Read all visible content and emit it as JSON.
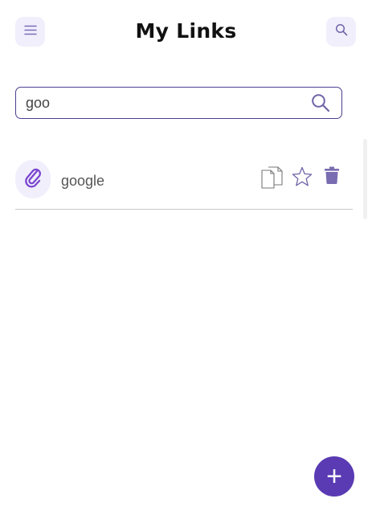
{
  "header": {
    "title": "My Links",
    "menu_icon": "hamburger-menu-icon",
    "search_icon": "search-icon"
  },
  "search": {
    "value": "goo",
    "icon": "search-icon"
  },
  "links": [
    {
      "name": "google",
      "icon": "paperclip-icon",
      "actions": [
        "copy-icon",
        "star-icon",
        "trash-icon"
      ]
    }
  ],
  "fab": {
    "label": "+",
    "icon": "plus-icon"
  },
  "colors": {
    "accent": "#5a3bb3",
    "icon_bg": "#f1effc",
    "icon_stroke": "#6e64a8",
    "border": "#4b3f8f"
  }
}
